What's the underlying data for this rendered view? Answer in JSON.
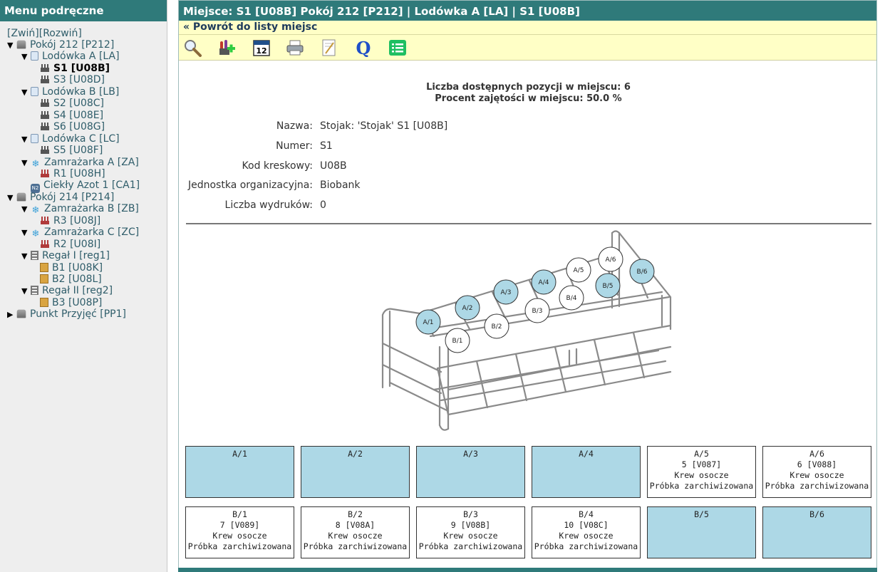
{
  "sidebar": {
    "title": "Menu podręczne",
    "collapse_label": "[Zwiń]",
    "expand_label": "[Rozwiń]",
    "nodes": [
      {
        "level": 0,
        "toggle": "▼",
        "icon": "room-icon",
        "icls": "ico-room",
        "label": "Pokój 212 [P212]"
      },
      {
        "level": 1,
        "toggle": "▼",
        "icon": "fridge-icon",
        "icls": "ico-fridge",
        "label": "Lodówka A [LA]"
      },
      {
        "level": 2,
        "toggle": "",
        "icon": "rack-icon",
        "icls": "ico-rack",
        "label": "S1 [U08B]",
        "current": true
      },
      {
        "level": 2,
        "toggle": "",
        "icon": "rack-icon",
        "icls": "ico-rack",
        "label": "S3 [U08D]"
      },
      {
        "level": 1,
        "toggle": "▼",
        "icon": "fridge-icon",
        "icls": "ico-fridge",
        "label": "Lodówka B [LB]"
      },
      {
        "level": 2,
        "toggle": "",
        "icon": "rack-icon",
        "icls": "ico-rack",
        "label": "S2 [U08C]"
      },
      {
        "level": 2,
        "toggle": "",
        "icon": "rack-icon",
        "icls": "ico-rack",
        "label": "S4 [U08E]"
      },
      {
        "level": 2,
        "toggle": "",
        "icon": "rack-icon",
        "icls": "ico-rack",
        "label": "S6 [U08G]"
      },
      {
        "level": 1,
        "toggle": "▼",
        "icon": "fridge-icon",
        "icls": "ico-fridge",
        "label": "Lodówka C [LC]"
      },
      {
        "level": 2,
        "toggle": "",
        "icon": "rack-icon",
        "icls": "ico-rack",
        "label": "S5 [U08F]"
      },
      {
        "level": 1,
        "toggle": "▼",
        "icon": "freezer-icon",
        "icls": "ico-freezer",
        "label": "Zamrażarka A [ZA]"
      },
      {
        "level": 2,
        "toggle": "",
        "icon": "red-rack-icon",
        "icls": "ico-redrack",
        "label": "R1 [U08H]"
      },
      {
        "level": 1,
        "toggle": "",
        "icon": "ln2-tank-icon",
        "icls": "ico-ln2",
        "label": "Ciekły Azot 1 [CA1]"
      },
      {
        "level": 0,
        "toggle": "▼",
        "icon": "room-icon",
        "icls": "ico-room",
        "label": "Pokój 214 [P214]"
      },
      {
        "level": 1,
        "toggle": "▼",
        "icon": "freezer-icon",
        "icls": "ico-freezer",
        "label": "Zamrażarka B [ZB]"
      },
      {
        "level": 2,
        "toggle": "",
        "icon": "red-rack-icon",
        "icls": "ico-redrack",
        "label": "R3 [U08J]"
      },
      {
        "level": 1,
        "toggle": "▼",
        "icon": "freezer-icon",
        "icls": "ico-freezer",
        "label": "Zamrażarka C [ZC]"
      },
      {
        "level": 2,
        "toggle": "",
        "icon": "red-rack-icon",
        "icls": "ico-redrack",
        "label": "R2 [U08I]"
      },
      {
        "level": 1,
        "toggle": "▼",
        "icon": "shelf-icon",
        "icls": "ico-shelf",
        "label": "Regał I [reg1]"
      },
      {
        "level": 2,
        "toggle": "",
        "icon": "box-icon",
        "icls": "ico-box",
        "label": "B1 [U08K]"
      },
      {
        "level": 2,
        "toggle": "",
        "icon": "box-icon",
        "icls": "ico-box",
        "label": "B2 [U08L]"
      },
      {
        "level": 1,
        "toggle": "▼",
        "icon": "shelf-icon",
        "icls": "ico-shelf",
        "label": "Regał II [reg2]"
      },
      {
        "level": 2,
        "toggle": "",
        "icon": "box-icon",
        "icls": "ico-box",
        "label": "B3 [U08P]"
      },
      {
        "level": 0,
        "toggle": "▶",
        "icon": "room-icon",
        "icls": "ico-room",
        "label": "Punkt Przyjęć [PP1]"
      }
    ]
  },
  "header": {
    "title": "Miejsce: S1 [U08B] Pokój 212 [P212] | Lodówka A [LA] | S1 [U08B]",
    "back_link": "« Powrót do listy miejsc"
  },
  "toolbar": {
    "buttons": [
      "search-icon",
      "add-sample-icon",
      "calendar-icon",
      "print-icon",
      "edit-note-icon",
      "query-icon",
      "list-icon"
    ],
    "calendar_day": "12",
    "query_letter": "Q"
  },
  "stats": {
    "available": "Liczba dostępnych pozycji w miejscu: 6",
    "occupancy": "Procent zajętości w miejscu: 50.0 %"
  },
  "details": [
    {
      "label": "Nazwa:",
      "value": "Stojak: 'Stojak' S1 [U08B]"
    },
    {
      "label": "Numer:",
      "value": "S1"
    },
    {
      "label": "Kod kreskowy:",
      "value": "U08B"
    },
    {
      "label": "Jednostka organizacyjna:",
      "value": "Biobank"
    },
    {
      "label": "Liczba wydruków:",
      "value": "0"
    }
  ],
  "rack_markers": [
    {
      "label": "A/1",
      "filled": false
    },
    {
      "label": "A/2",
      "filled": false
    },
    {
      "label": "A/3",
      "filled": false
    },
    {
      "label": "A/4",
      "filled": false
    },
    {
      "label": "A/5",
      "filled": true
    },
    {
      "label": "A/6",
      "filled": true
    },
    {
      "label": "B/1",
      "filled": true
    },
    {
      "label": "B/2",
      "filled": true
    },
    {
      "label": "B/3",
      "filled": true
    },
    {
      "label": "B/4",
      "filled": true
    },
    {
      "label": "B/5",
      "filled": false
    },
    {
      "label": "B/6",
      "filled": false
    }
  ],
  "slots": [
    {
      "pos": "A/1",
      "lines": []
    },
    {
      "pos": "A/2",
      "lines": []
    },
    {
      "pos": "A/3",
      "lines": []
    },
    {
      "pos": "A/4",
      "lines": []
    },
    {
      "pos": "A/5",
      "lines": [
        "5 [V087]",
        "Krew osocze",
        "Próbka zarchiwizowana"
      ]
    },
    {
      "pos": "A/6",
      "lines": [
        "6 [V088]",
        "Krew osocze",
        "Próbka zarchiwizowana"
      ]
    },
    {
      "pos": "B/1",
      "lines": [
        "7 [V089]",
        "Krew osocze",
        "Próbka zarchiwizowana"
      ]
    },
    {
      "pos": "B/2",
      "lines": [
        "8 [V08A]",
        "Krew osocze",
        "Próbka zarchiwizowana"
      ]
    },
    {
      "pos": "B/3",
      "lines": [
        "9 [V08B]",
        "Krew osocze",
        "Próbka zarchiwizowana"
      ]
    },
    {
      "pos": "B/4",
      "lines": [
        "10 [V08C]",
        "Krew osocze",
        "Próbka zarchiwizowana"
      ]
    },
    {
      "pos": "B/5",
      "lines": []
    },
    {
      "pos": "B/6",
      "lines": []
    }
  ],
  "colors": {
    "header_teal": "#2f7a7a",
    "toolbar_yellow": "#ffffc6",
    "empty_slot": "#add8e6",
    "filled_slot": "#ffffff"
  }
}
